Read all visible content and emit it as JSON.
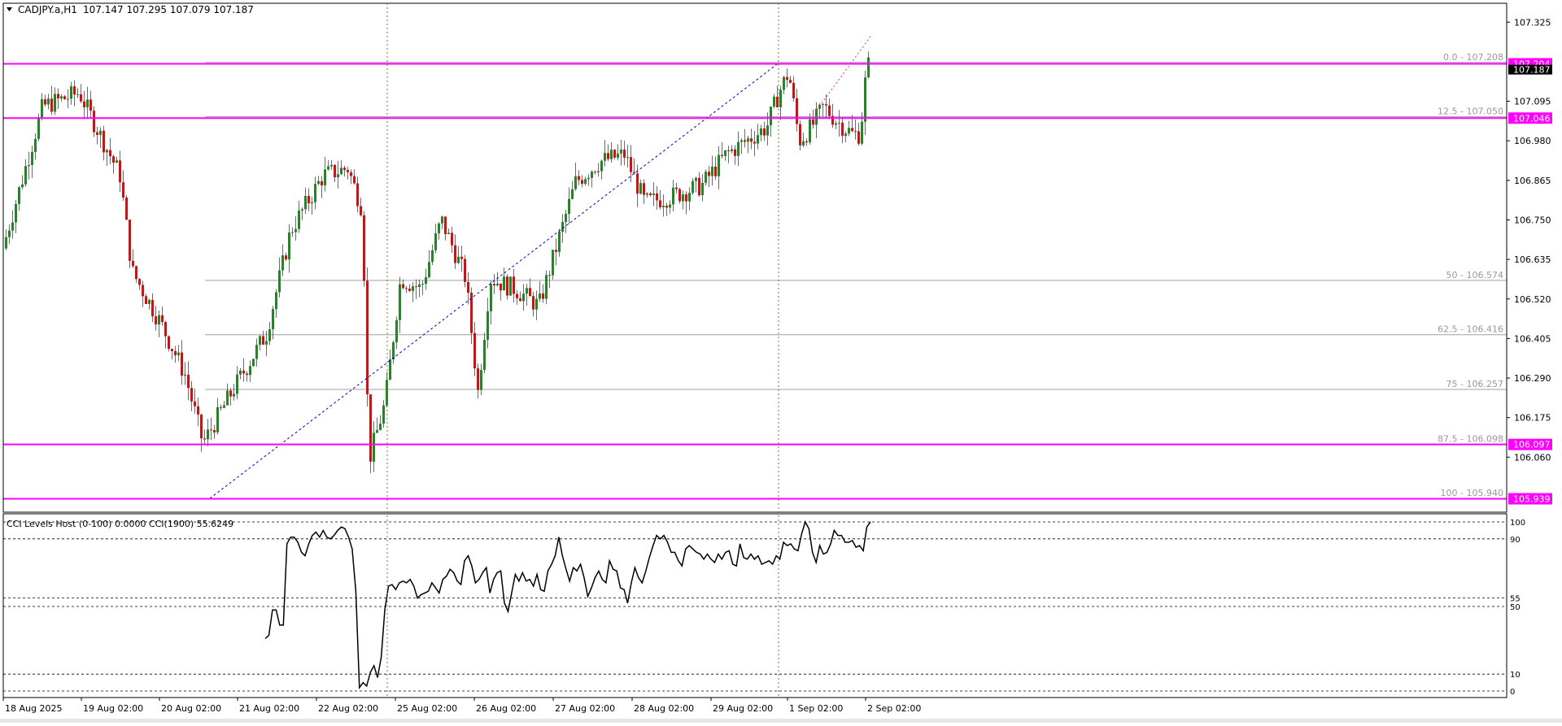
{
  "chart_data": [
    {
      "type": "candlestick",
      "title": "CADJPY.a,H1",
      "ohlc_header": "107.147 107.295 107.079 107.187",
      "price_axis_ticks": [
        "107.325",
        "107.095",
        "106.980",
        "106.865",
        "106.750",
        "106.635",
        "106.520",
        "106.405",
        "106.290",
        "106.175",
        "106.060"
      ],
      "ylim": [
        105.9,
        107.38
      ],
      "time_labels": [
        "18 Aug 2025",
        "19 Aug 02:00",
        "20 Aug 02:00",
        "21 Aug 02:00",
        "22 Aug 02:00",
        "25 Aug 02:00",
        "26 Aug 02:00",
        "27 Aug 02:00",
        "28 Aug 02:00",
        "29 Aug 02:00",
        "1 Sep 02:00",
        "2 Sep 02:00"
      ],
      "current_price": "107.187",
      "horizontal_lines": [
        {
          "price": 107.204,
          "label": "107.204"
        },
        {
          "price": 107.046,
          "label": "107.046"
        },
        {
          "price": 106.097,
          "label": "106.097"
        },
        {
          "price": 105.939,
          "label": "105.939"
        }
      ],
      "fibonacci_levels": [
        {
          "label": "0.0 - 107.208",
          "price": 107.208
        },
        {
          "label": "12.5 - 107.050",
          "price": 107.05
        },
        {
          "label": "50 - 106.574",
          "price": 106.574
        },
        {
          "label": "62.5 - 106.416",
          "price": 106.416
        },
        {
          "label": "75 - 106.257",
          "price": 106.257
        },
        {
          "label": "87.5 - 106.098",
          "price": 106.098
        },
        {
          "label": "100 - 105.940",
          "price": 105.94
        }
      ],
      "vertical_separators": [
        "25 Aug 02:00",
        "1 Sep 02:00"
      ],
      "colors": {
        "bull": "#2e7d32",
        "bear": "#b71c1c",
        "levels": "#ff00ff",
        "fib": "#a0a0a0",
        "trend": "#0000cc"
      }
    },
    {
      "type": "line",
      "title": "CCI Levels Host (0-100) 0.0000  CCI(1900) 55.6249",
      "levels": [
        "100",
        "90",
        "55",
        "50",
        "10",
        "0"
      ],
      "ylim": [
        0,
        100
      ],
      "series": [
        {
          "name": "CCI(1900)",
          "values": [
            31,
            33,
            48,
            48,
            39,
            39,
            87,
            91,
            91,
            88,
            82,
            80,
            87,
            92,
            94,
            91,
            95,
            91,
            90,
            92,
            95,
            97,
            96,
            91,
            84,
            59,
            2,
            5,
            3,
            11,
            15,
            8,
            20,
            48,
            62,
            63,
            60,
            64,
            65,
            64,
            66,
            62,
            55,
            57,
            58,
            59,
            64,
            61,
            58,
            66,
            68,
            72,
            70,
            65,
            63,
            77,
            80,
            74,
            64,
            66,
            70,
            73,
            58,
            66,
            70,
            71,
            52,
            47,
            58,
            69,
            65,
            70,
            65,
            66,
            62,
            69,
            60,
            59,
            71,
            75,
            80,
            91,
            80,
            72,
            65,
            73,
            71,
            75,
            67,
            56,
            61,
            67,
            71,
            66,
            64,
            77,
            72,
            71,
            61,
            60,
            52,
            64,
            73,
            67,
            64,
            71,
            79,
            86,
            92,
            90,
            92,
            88,
            82,
            82,
            77,
            74,
            84,
            86,
            84,
            82,
            81,
            78,
            81,
            78,
            76,
            81,
            78,
            82,
            83,
            75,
            74,
            87,
            79,
            78,
            81,
            78,
            80,
            75,
            76,
            77,
            75,
            80,
            78,
            88,
            86,
            87,
            84,
            83,
            93,
            100,
            96,
            82,
            76,
            86,
            81,
            82,
            87,
            95,
            92,
            92,
            88,
            88,
            89,
            85,
            86,
            83,
            97,
            100
          ]
        }
      ]
    }
  ]
}
